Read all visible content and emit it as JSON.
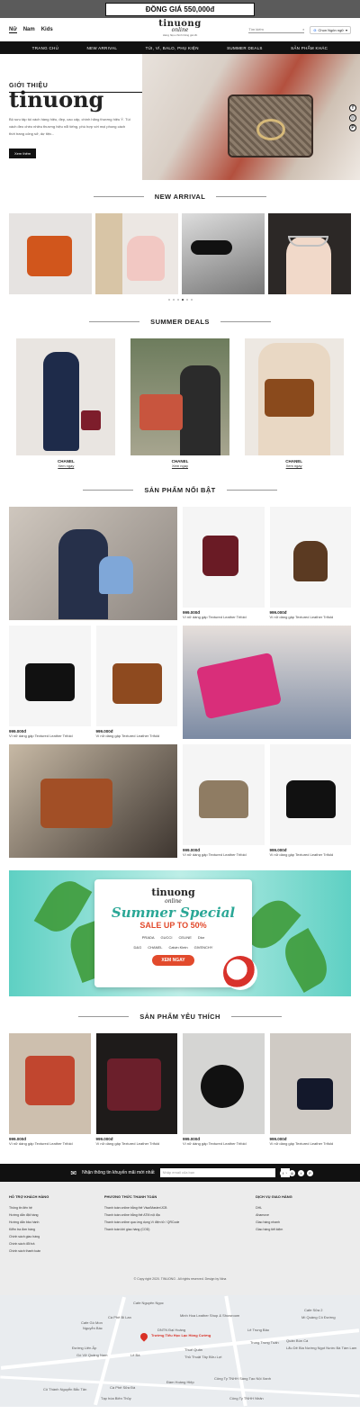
{
  "promo_bar": "ĐỒNG GIÁ 550,000đ",
  "header": {
    "categories": [
      "Nữ",
      "Nam",
      "Kids"
    ],
    "logo_main": "tinuong",
    "logo_script": "online",
    "logo_tag": "Hàng hiệu chính hãng giá tốt",
    "search_placeholder": "Tìm kiếm",
    "language": "Chọn Ngôn ngữ"
  },
  "nav": [
    "TRANG CHỦ",
    "NEW ARRIVAL",
    "TÚI, VÍ, BALO, PHỤ KIỆN",
    "SUMMER DEALS",
    "SẢN PHẨM KHÁC"
  ],
  "hero": {
    "subtitle": "GIỚI THIỆU",
    "brand": "tinuong",
    "description": "Bộ sưu tập túi xách hàng hiệu, đẹp, cao cấp, chính hãng thương hiệu Ý. Túi xách đeo chéo nhiều thương hiệu nổi tiếng, phù hợp với mọi phong cách thời trang công sở, dự tiệc...",
    "button": "Xem thêm"
  },
  "sections": {
    "new_arrival": "NEW ARRIVAL",
    "summer_deals": "SUMMER DEALS",
    "featured": "SẢN PHẨM NỔI BẬT",
    "favorites": "SẢN PHẨM YÊU THÍCH"
  },
  "deals": [
    {
      "name": "CHANEL",
      "link": "Xem ngay"
    },
    {
      "name": "CHANEL",
      "link": "Xem ngay"
    },
    {
      "name": "CHANEL",
      "link": "Xem ngay"
    }
  ],
  "product": {
    "price": "999.000đ",
    "name": "Ví nữ dáng gập Textured Leather Trifold"
  },
  "banner": {
    "title": "tinuong",
    "script": "online",
    "headline": "Summer Special",
    "sale": "SALE UP TO 50%",
    "brands": [
      "PRADA",
      "GUCCI",
      "CELINE",
      "Dior",
      "D&G",
      "CHANEL",
      "Calvin Klein",
      "GIVENCHY"
    ],
    "cta": "XEM NGAY"
  },
  "newsletter": {
    "text": "Nhận thông tin khuyến mãi mới nhất",
    "placeholder": "Nhập email của bạn"
  },
  "footer": {
    "col1": {
      "title": "HỖ TRỢ KHÁCH HÀNG",
      "items": [
        "Thông tin liên hệ",
        "Hướng dẫn đặt hàng",
        "Hướng dẫn bảo hành",
        "Kiểm tra đơn hàng",
        "Chính sách giao hàng",
        "Chính sách đổi trả",
        "Chính sách thanh toán"
      ]
    },
    "col2": {
      "title": "PHƯƠNG THỨC THANH TOÁN",
      "items": [
        "Thanh toán online bằng thẻ Visa/Master/JCB",
        "Thanh toán online bằng thẻ ATM nội địa",
        "Thanh toán online qua ứng dụng Ví điện tử / QRCode",
        "Thanh toán khi giao hàng (COD)"
      ]
    },
    "col3": {
      "title": "DỊCH VỤ GIAO HÀNG",
      "items": [
        "DHL",
        "Ahamove",
        "Giao hàng nhanh",
        "Giao hàng tiết kiệm"
      ]
    },
    "copyright": "© Copy right 2020. TINUONG . All rights reserved. Design by Nina"
  },
  "map": {
    "pin": "Trường Tiểu Học Lạc Hồng Cường",
    "labels": [
      "Cafe Nguyên Ngọc",
      "Cà Phê Bi Lan",
      "Cafe Gò Mon",
      "Nguyễn Bác",
      "Minh Hoa Leather Shop & Showroom",
      "DNTN Đại Hoàng",
      "Thuế Quân",
      "Thủ Thuật Tây Bửu Lợi",
      "Lê Bá",
      "Lê Trung Bảo",
      "Trung Trung Tuấn",
      "Đường Liên Ấp",
      "Gò Vỡ Quảng Nam",
      "Cà Phê Sữa Đà",
      "Cô Thành Nguyễn Bắc Tân",
      "Tạp hóa Biên Thủy",
      "Đàm Hoàng Hiệp",
      "Công Ty TNHH Sáng Tạo Nội Xanh",
      "Mì Quảng Cô Đường",
      "Quán Bún Cá",
      "Lẩu Dê Bia Nướng Ngọt Nước Bà Tám Lam",
      "Cafe Sữa 2",
      "Công Ty TNHH Nhân"
    ]
  },
  "colors": {
    "accent": "#e24a2c",
    "dark": "#111111",
    "teal": "#5ed0c3"
  }
}
